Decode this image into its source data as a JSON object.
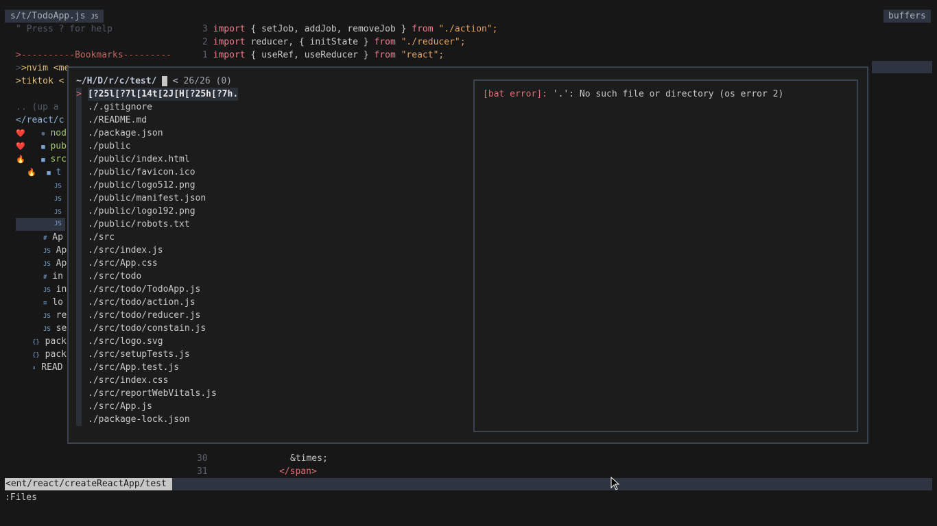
{
  "tabline": {
    "file_tab": "s/t/TodoApp.js",
    "file_tab_badge": "JS",
    "buffers": "buffers"
  },
  "sidebar": {
    "help": "\" Press ? for help",
    "bookmarks_header": ">----------Bookmarks---------",
    "bookmark_1": ">nvim <me",
    "bookmark_2": ">tiktok <",
    "up_dir": ".. (up a",
    "current_dir": "</react/c",
    "tree": [
      {
        "mark": "❤️",
        "icon": "⊚",
        "label": "nod"
      },
      {
        "mark": "❤️",
        "icon": "■",
        "label": "pub"
      },
      {
        "mark": "🔥",
        "icon": "■",
        "label": "src"
      },
      {
        "mark": "🔥",
        "icon": "■",
        "label": "t"
      },
      {
        "icon": "JS",
        "label": ""
      },
      {
        "icon": "JS",
        "label": ""
      },
      {
        "icon": "JS",
        "label": ""
      },
      {
        "icon": "JS",
        "label": ""
      },
      {
        "icon": "#",
        "label": "Ap"
      },
      {
        "icon": "JS",
        "label": "Ap"
      },
      {
        "icon": "JS",
        "label": "Ap"
      },
      {
        "icon": "#",
        "label": "in"
      },
      {
        "icon": "JS",
        "label": "in"
      },
      {
        "icon": "≡",
        "label": "lo"
      },
      {
        "icon": "JS",
        "label": "re"
      },
      {
        "icon": "JS",
        "label": "se"
      },
      {
        "icon": "{}",
        "label": "pack"
      },
      {
        "icon": "{}",
        "label": "pack"
      },
      {
        "icon": "⬇",
        "label": "READ"
      }
    ]
  },
  "editor": {
    "lines_top": [
      {
        "num": "3",
        "parts": [
          "import",
          " { setJob, addJob, removeJob } ",
          "from",
          " \"./action\";"
        ]
      },
      {
        "num": "2",
        "parts": [
          "import",
          " reducer, { initState } ",
          "from",
          " \"./reducer\";"
        ]
      },
      {
        "num": "1",
        "parts": [
          "import",
          " { useRef, useReducer } ",
          "from",
          " \"react\";"
        ]
      }
    ],
    "line_30_num": "30",
    "line_30_text": "&times;",
    "line_31_num": "31",
    "line_31_text": "</span>"
  },
  "fzf": {
    "prompt_path": "~/H/D/r/c/test/",
    "prompt_symbol": "<",
    "count": "26/26 (0)",
    "pointer": ">",
    "items": [
      "[?25l[?7l[14t[2J[H[?25h[?7h.",
      "./.gitignore",
      "./README.md",
      "./package.json",
      "./public",
      "./public/index.html",
      "./public/favicon.ico",
      "./public/logo512.png",
      "./public/manifest.json",
      "./public/logo192.png",
      "./public/robots.txt",
      "./src",
      "./src/index.js",
      "./src/App.css",
      "./src/todo",
      "./src/todo/TodoApp.js",
      "./src/todo/action.js",
      "./src/todo/reducer.js",
      "./src/todo/constain.js",
      "./src/logo.svg",
      "./src/setupTests.js",
      "./src/App.test.js",
      "./src/index.css",
      "./src/reportWebVitals.js",
      "./src/App.js",
      "./package-lock.json"
    ],
    "preview_error_tag": "[bat error]:",
    "preview_error_msg": " '.': No such file or directory (os error 2)"
  },
  "statusline": {
    "path": "<ent/react/createReactApp/test"
  },
  "cmdline": {
    "text": ":Files"
  },
  "colors": {
    "background": "#171717",
    "tab_bg": "#2e3440",
    "keyword": "#ef7c8e",
    "string": "#e0a060",
    "error": "#e06c75"
  }
}
